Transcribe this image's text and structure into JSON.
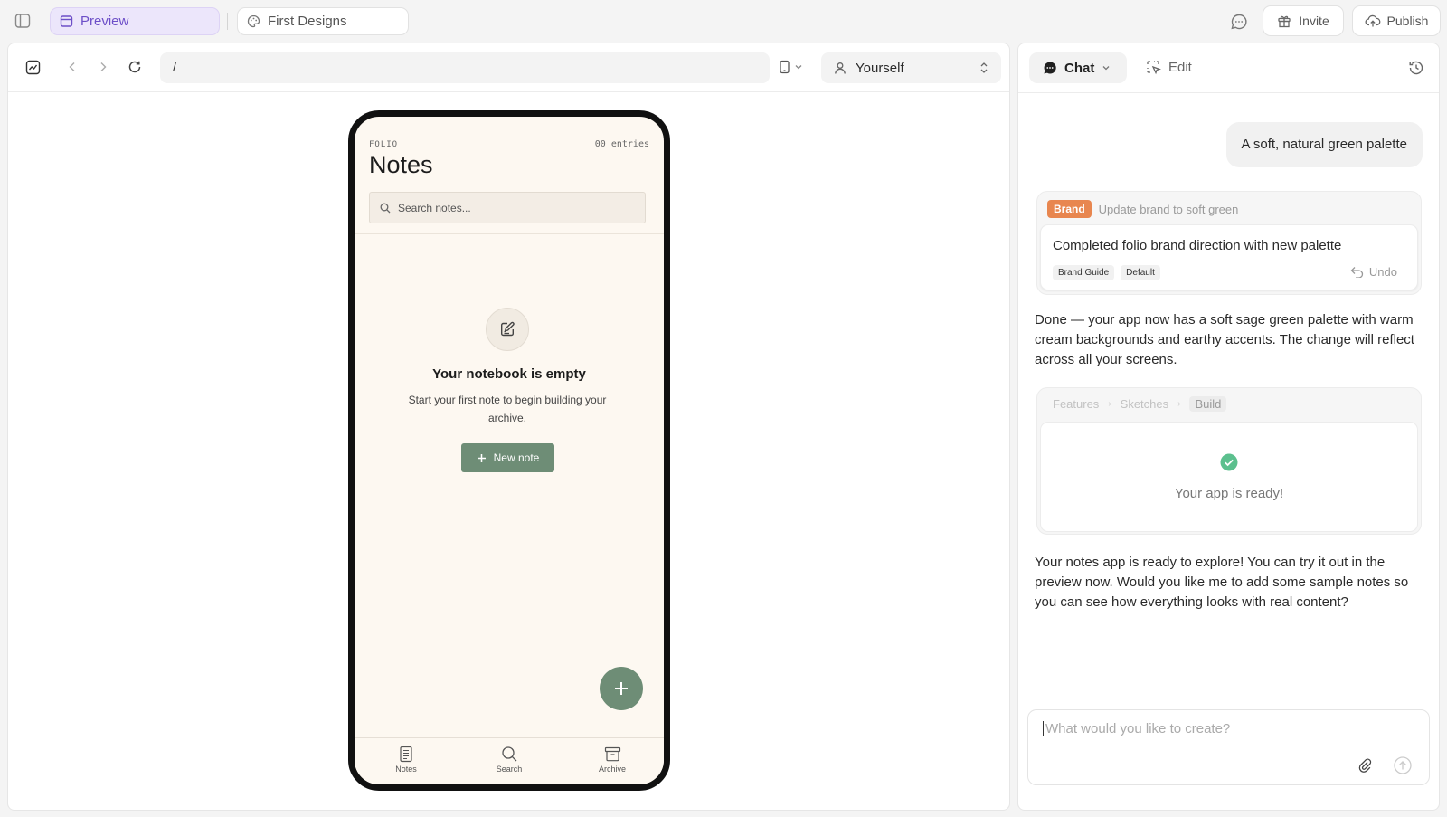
{
  "topbar": {
    "preview_tab": "Preview",
    "designs_tab": "First Designs",
    "invite_label": "Invite",
    "publish_label": "Publish"
  },
  "preview": {
    "url": "/",
    "viewer": "Yourself"
  },
  "phone": {
    "eyebrow": "FOLIO",
    "count": "00 entries",
    "title": "Notes",
    "search_placeholder": "Search notes...",
    "empty_title": "Your notebook is empty",
    "empty_desc": "Start your first note to begin building your archive.",
    "new_note_label": "New note",
    "nav": [
      {
        "label": "Notes",
        "icon": "notes-icon"
      },
      {
        "label": "Search",
        "icon": "search-icon"
      },
      {
        "label": "Archive",
        "icon": "archive-icon"
      }
    ],
    "accent": "#6e8d76",
    "background": "#fdf8f1"
  },
  "chat": {
    "chat_tab": "Chat",
    "edit_tab": "Edit",
    "user_message": "A soft, natural green palette",
    "brand_badge": "Brand",
    "brand_update": "Update brand to soft green",
    "brand_card_title": "Completed folio brand direction with new palette",
    "brand_tags": [
      "Brand Guide",
      "Default"
    ],
    "undo_label": "Undo",
    "assistant_message_1": "Done — your app now has a soft sage green palette with warm cream backgrounds and earthy accents. The change will reflect across all your screens.",
    "build_steps": [
      "Features",
      "Sketches",
      "Build"
    ],
    "ready_text": "Your app is ready!",
    "assistant_message_2": "Your notes app is ready to explore! You can try it out in the preview now. Would you like me to add some sample notes so you can see how everything looks with real content?",
    "input_placeholder": "What would you like to create?",
    "accent_colors": {
      "brand_badge": "#e8864f",
      "success": "#5cc08e",
      "preview_tab": "#6d4fc8"
    }
  }
}
